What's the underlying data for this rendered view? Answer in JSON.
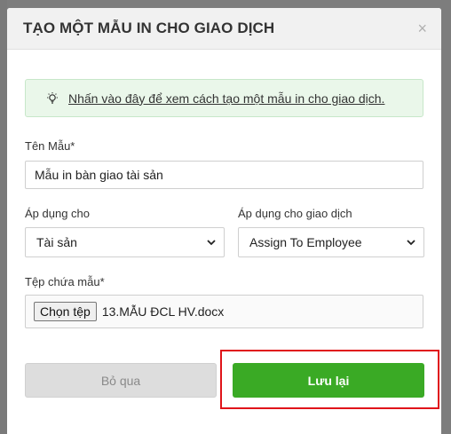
{
  "dialog": {
    "title": "TẠO MỘT MẪU IN CHO GIAO DỊCH",
    "close_glyph": "×"
  },
  "hint": {
    "icon": "lightbulb-icon",
    "text": "Nhấn vào đây để xem cách tạo một mẫu in cho giao dịch."
  },
  "form": {
    "template_name_label": "Tên Mẫu*",
    "template_name_value": "Mẫu in bàn giao tài sản",
    "apply_for_label": "Áp dụng cho",
    "apply_for_value": "Tài sản",
    "apply_transaction_label": "Áp dụng cho giao dịch",
    "apply_transaction_value": "Assign To Employee",
    "file_label": "Tệp chứa mẫu*",
    "file_button_label": "Chọn tệp",
    "file_name": "13.MẪU ĐCL HV.docx"
  },
  "actions": {
    "cancel_label": "Bỏ qua",
    "save_label": "Lưu lại"
  },
  "colors": {
    "save_button": "#3aaa25",
    "cancel_button": "#dddddd",
    "hint_background": "#eaf7ea",
    "highlight_border": "#e0141a"
  }
}
